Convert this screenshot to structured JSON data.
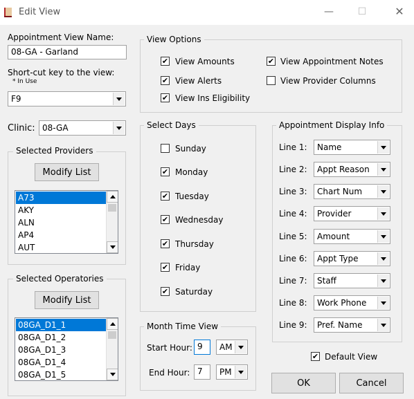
{
  "window": {
    "title": "Edit View",
    "minimize": "—",
    "maximize": "☐",
    "close": "✕"
  },
  "view_name": {
    "label": "Appointment View Name:",
    "value": "08-GA - Garland"
  },
  "shortcut": {
    "label": "Short-cut key to the view:",
    "note": "* In Use",
    "value": "F9"
  },
  "clinic": {
    "label": "Clinic:",
    "value": "08-GA"
  },
  "providers": {
    "legend": "Selected Providers",
    "modify_label": "Modify List",
    "items": [
      "A73",
      "AKY",
      "ALN",
      "AP4",
      "AUT"
    ],
    "selected_index": 0
  },
  "operatories": {
    "legend": "Selected Operatories",
    "modify_label": "Modify List",
    "items": [
      "08GA_D1_1",
      "08GA_D1_2",
      "08GA_D1_3",
      "08GA_D1_4",
      "08GA_D1_5"
    ],
    "selected_index": 0
  },
  "view_options": {
    "legend": "View Options",
    "items": [
      {
        "label": "View Amounts",
        "checked": true
      },
      {
        "label": "View Alerts",
        "checked": true
      },
      {
        "label": "View Ins Eligibility",
        "checked": true
      },
      {
        "label": "View Appointment Notes",
        "checked": true
      },
      {
        "label": "View Provider Columns",
        "checked": false
      }
    ]
  },
  "select_days": {
    "legend": "Select Days",
    "days": [
      {
        "label": "Sunday",
        "checked": false
      },
      {
        "label": "Monday",
        "checked": true
      },
      {
        "label": "Tuesday",
        "checked": true
      },
      {
        "label": "Wednesday",
        "checked": true
      },
      {
        "label": "Thursday",
        "checked": true
      },
      {
        "label": "Friday",
        "checked": true
      },
      {
        "label": "Saturday",
        "checked": true
      }
    ]
  },
  "month_time": {
    "legend": "Month Time View",
    "start_label": "Start Hour:",
    "start_hour": "9",
    "start_ampm": "AM",
    "end_label": "End Hour:",
    "end_hour": "7",
    "end_ampm": "PM"
  },
  "display_info": {
    "legend": "Appointment Display Info",
    "lines": [
      {
        "label": "Line 1:",
        "value": "Name"
      },
      {
        "label": "Line 2:",
        "value": "Appt Reason"
      },
      {
        "label": "Line 3:",
        "value": "Chart Num"
      },
      {
        "label": "Line 4:",
        "value": "Provider"
      },
      {
        "label": "Line 5:",
        "value": "Amount"
      },
      {
        "label": "Line 6:",
        "value": "Appt Type"
      },
      {
        "label": "Line 7:",
        "value": "Staff"
      },
      {
        "label": "Line 8:",
        "value": "Work Phone"
      },
      {
        "label": "Line 9:",
        "value": "Pref. Name"
      }
    ]
  },
  "default_view": {
    "label": "Default View",
    "checked": true
  },
  "buttons": {
    "ok": "OK",
    "cancel": "Cancel"
  },
  "check_glyph": "✔",
  "colors": {
    "selection": "#0078d7",
    "window_bg": "#f0f0f0",
    "focus_border": "#0078d7",
    "app_icon": "#b3262b"
  }
}
